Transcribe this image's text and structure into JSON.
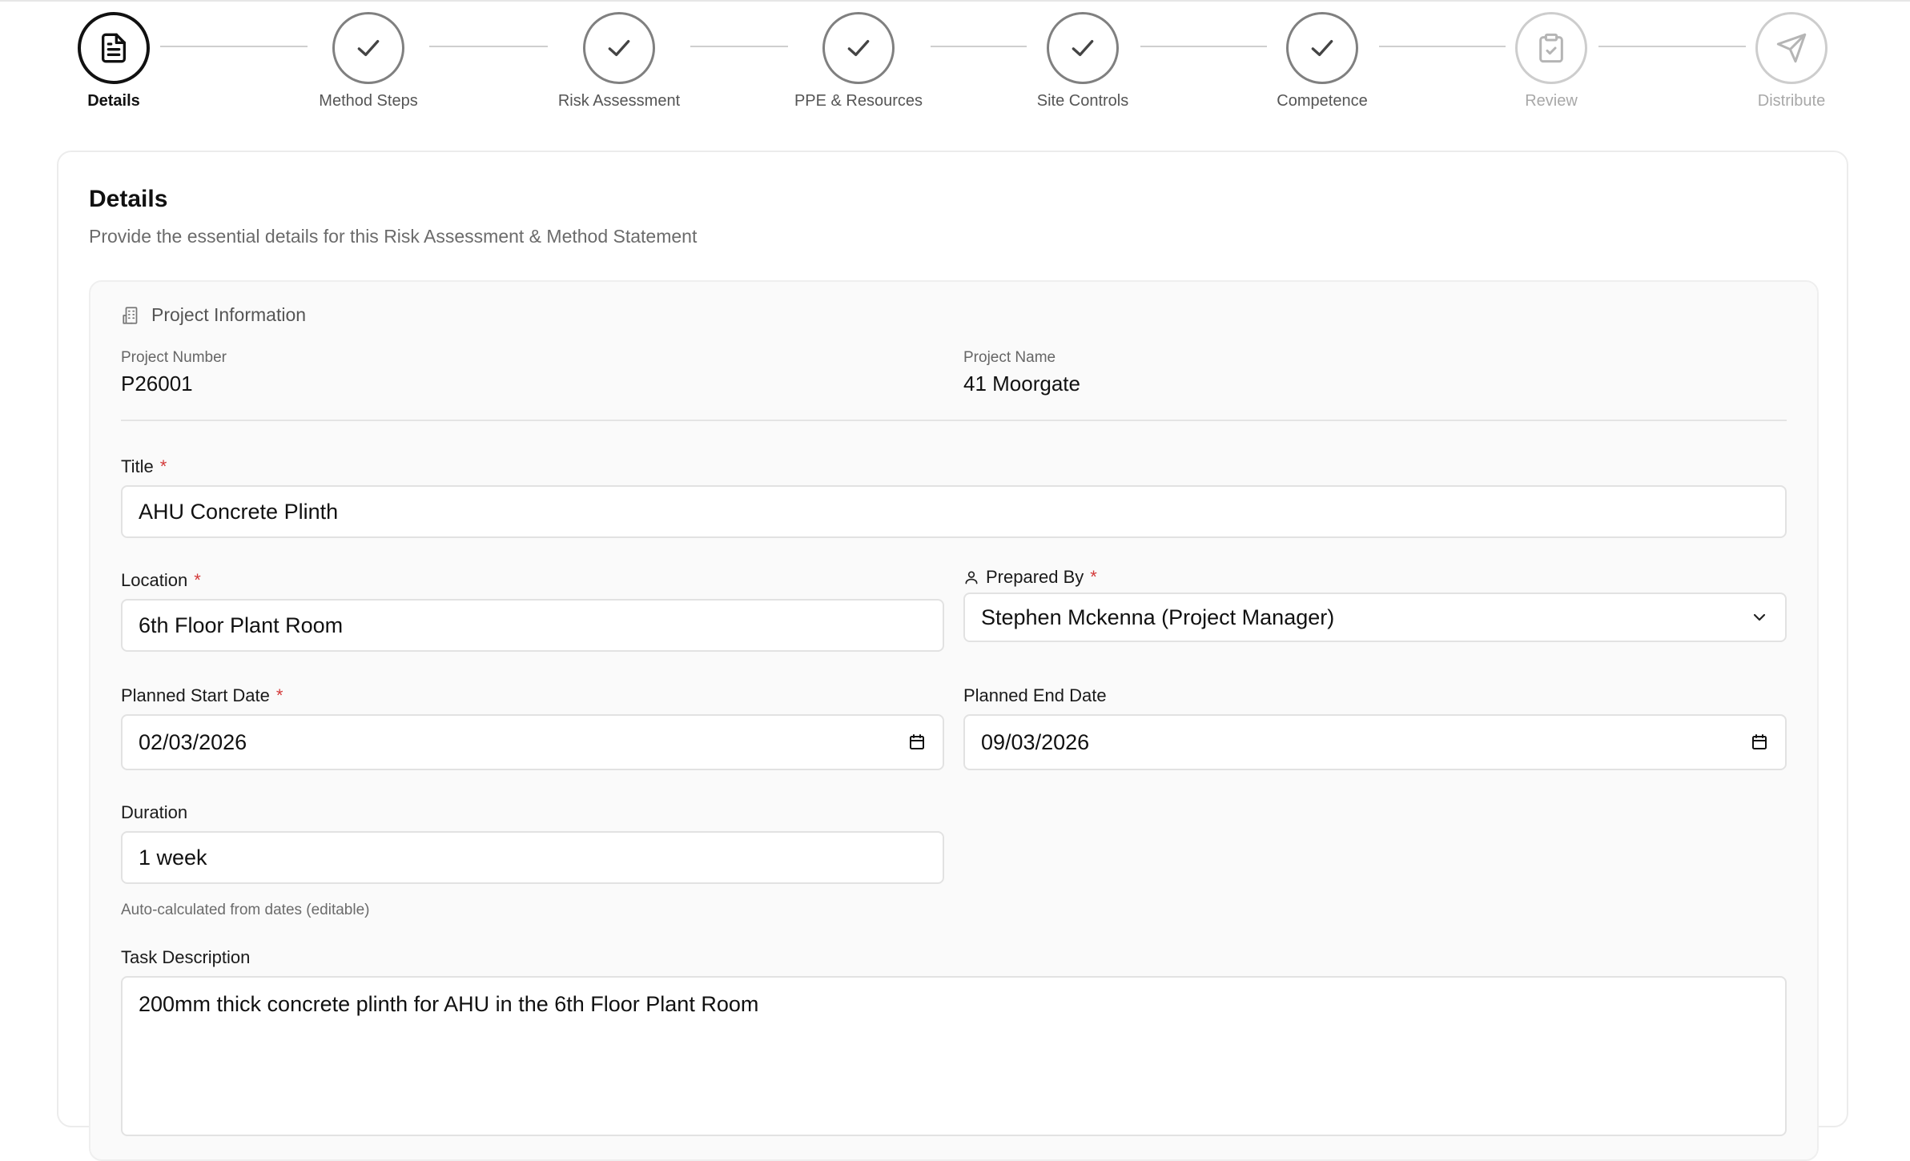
{
  "stepper": {
    "steps": [
      {
        "label": "Details",
        "state": "active",
        "icon": "document-icon"
      },
      {
        "label": "Method Steps",
        "state": "done",
        "icon": "check-icon"
      },
      {
        "label": "Risk Assessment",
        "state": "done",
        "icon": "check-icon"
      },
      {
        "label": "PPE & Resources",
        "state": "done",
        "icon": "check-icon"
      },
      {
        "label": "Site Controls",
        "state": "done",
        "icon": "check-icon"
      },
      {
        "label": "Competence",
        "state": "done",
        "icon": "check-icon"
      },
      {
        "label": "Review",
        "state": "pending",
        "icon": "clipboard-check-icon"
      },
      {
        "label": "Distribute",
        "state": "pending",
        "icon": "send-icon"
      }
    ]
  },
  "card": {
    "title": "Details",
    "subtitle": "Provide the essential details for this Risk Assessment & Method Statement"
  },
  "project": {
    "section_title": "Project Information",
    "section_icon": "building-icon",
    "number_label": "Project Number",
    "number_value": "P26001",
    "name_label": "Project Name",
    "name_value": "41 Moorgate"
  },
  "form": {
    "required_mark": "*",
    "title_label": "Title",
    "title_value": "AHU Concrete Plinth",
    "location_label": "Location",
    "location_value": "6th Floor Plant Room",
    "prepared_by_label": "Prepared By",
    "prepared_by_value": "Stephen Mckenna (Project Manager)",
    "start_label": "Planned Start Date",
    "start_value": "02/03/2026",
    "end_label": "Planned End Date",
    "end_value": "09/03/2026",
    "duration_label": "Duration",
    "duration_value": "1 week",
    "duration_hint": "Auto-calculated from dates (editable)",
    "task_label": "Task Description",
    "task_value": "200mm thick concrete plinth for AHU in the 6th Floor Plant Room"
  },
  "colors": {
    "active": "#111111",
    "done": "#808080",
    "pending": "#cdcdcd",
    "required": "#d33a3a"
  }
}
